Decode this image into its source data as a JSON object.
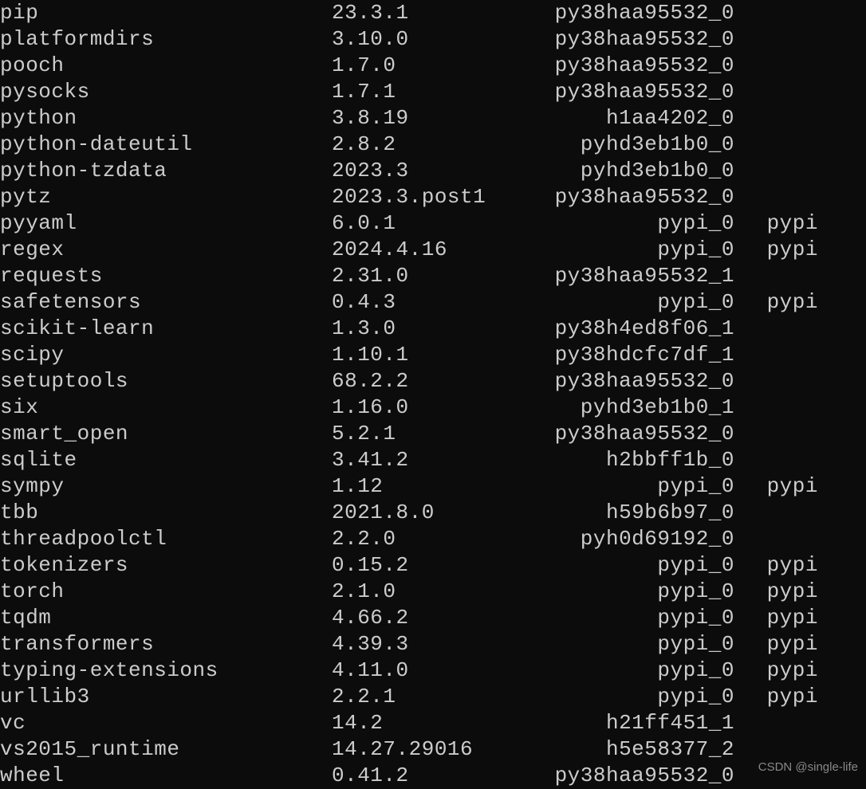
{
  "packages": [
    {
      "name": "pip",
      "version": "23.3.1",
      "build": "py38haa95532_0",
      "channel": ""
    },
    {
      "name": "platformdirs",
      "version": "3.10.0",
      "build": "py38haa95532_0",
      "channel": ""
    },
    {
      "name": "pooch",
      "version": "1.7.0",
      "build": "py38haa95532_0",
      "channel": ""
    },
    {
      "name": "pysocks",
      "version": "1.7.1",
      "build": "py38haa95532_0",
      "channel": ""
    },
    {
      "name": "python",
      "version": "3.8.19",
      "build": "h1aa4202_0",
      "channel": ""
    },
    {
      "name": "python-dateutil",
      "version": "2.8.2",
      "build": "pyhd3eb1b0_0",
      "channel": ""
    },
    {
      "name": "python-tzdata",
      "version": "2023.3",
      "build": "pyhd3eb1b0_0",
      "channel": ""
    },
    {
      "name": "pytz",
      "version": "2023.3.post1",
      "build": "py38haa95532_0",
      "channel": ""
    },
    {
      "name": "pyyaml",
      "version": "6.0.1",
      "build": "pypi_0",
      "channel": "pypi"
    },
    {
      "name": "regex",
      "version": "2024.4.16",
      "build": "pypi_0",
      "channel": "pypi"
    },
    {
      "name": "requests",
      "version": "2.31.0",
      "build": "py38haa95532_1",
      "channel": ""
    },
    {
      "name": "safetensors",
      "version": "0.4.3",
      "build": "pypi_0",
      "channel": "pypi"
    },
    {
      "name": "scikit-learn",
      "version": "1.3.0",
      "build": "py38h4ed8f06_1",
      "channel": ""
    },
    {
      "name": "scipy",
      "version": "1.10.1",
      "build": "py38hdcfc7df_1",
      "channel": ""
    },
    {
      "name": "setuptools",
      "version": "68.2.2",
      "build": "py38haa95532_0",
      "channel": ""
    },
    {
      "name": "six",
      "version": "1.16.0",
      "build": "pyhd3eb1b0_1",
      "channel": ""
    },
    {
      "name": "smart_open",
      "version": "5.2.1",
      "build": "py38haa95532_0",
      "channel": ""
    },
    {
      "name": "sqlite",
      "version": "3.41.2",
      "build": "h2bbff1b_0",
      "channel": ""
    },
    {
      "name": "sympy",
      "version": "1.12",
      "build": "pypi_0",
      "channel": "pypi"
    },
    {
      "name": "tbb",
      "version": "2021.8.0",
      "build": "h59b6b97_0",
      "channel": ""
    },
    {
      "name": "threadpoolctl",
      "version": "2.2.0",
      "build": "pyh0d69192_0",
      "channel": ""
    },
    {
      "name": "tokenizers",
      "version": "0.15.2",
      "build": "pypi_0",
      "channel": "pypi"
    },
    {
      "name": "torch",
      "version": "2.1.0",
      "build": "pypi_0",
      "channel": "pypi"
    },
    {
      "name": "tqdm",
      "version": "4.66.2",
      "build": "pypi_0",
      "channel": "pypi"
    },
    {
      "name": "transformers",
      "version": "4.39.3",
      "build": "pypi_0",
      "channel": "pypi"
    },
    {
      "name": "typing-extensions",
      "version": "4.11.0",
      "build": "pypi_0",
      "channel": "pypi"
    },
    {
      "name": "urllib3",
      "version": "2.2.1",
      "build": "pypi_0",
      "channel": "pypi"
    },
    {
      "name": "vc",
      "version": "14.2",
      "build": "h21ff451_1",
      "channel": ""
    },
    {
      "name": "vs2015_runtime",
      "version": "14.27.29016",
      "build": "h5e58377_2",
      "channel": ""
    },
    {
      "name": "wheel",
      "version": "0.41.2",
      "build": "py38haa95532_0",
      "channel": ""
    }
  ],
  "watermark": "CSDN @single-life"
}
